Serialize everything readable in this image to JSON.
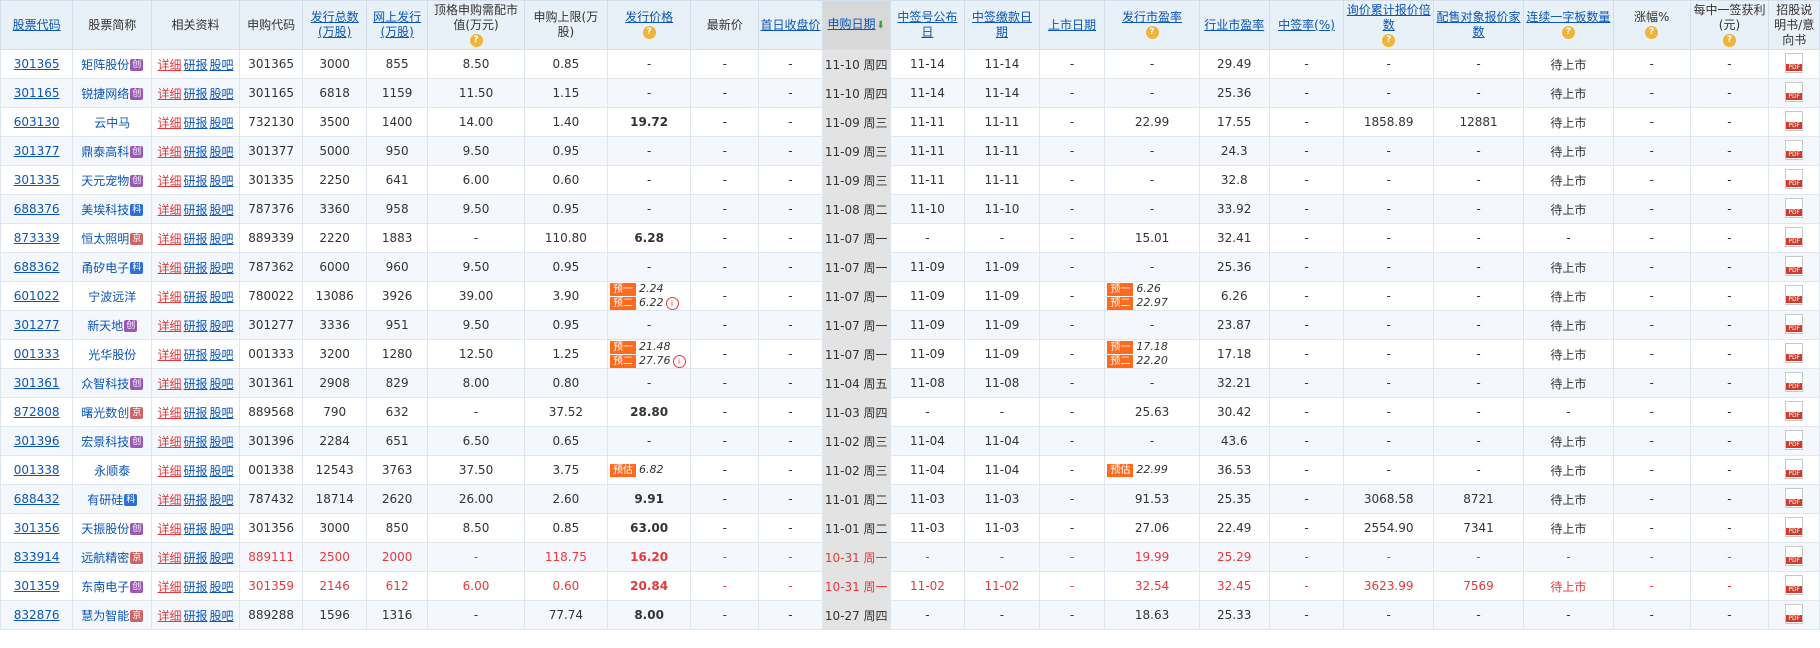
{
  "headers": [
    {
      "label": "股票代码",
      "link": true
    },
    {
      "label": "股票简称"
    },
    {
      "label": "相关资料"
    },
    {
      "label": "申购代码"
    },
    {
      "label": "发行总数(万股)",
      "link": true
    },
    {
      "label": "网上发行(万股)",
      "link": true
    },
    {
      "label": "顶格申购需配市值(万元)",
      "q": true
    },
    {
      "label": "申购上限(万股)"
    },
    {
      "label": "发行价格",
      "link": true,
      "q": true
    },
    {
      "label": "最新价"
    },
    {
      "label": "首日收盘价",
      "link": true
    },
    {
      "label": "申购日期",
      "link": true,
      "arrow": true
    },
    {
      "label": "中签号公布日",
      "link": true
    },
    {
      "label": "中签缴款日期",
      "link": true
    },
    {
      "label": "上市日期",
      "link": true
    },
    {
      "label": "发行市盈率",
      "link": true,
      "q": true
    },
    {
      "label": "行业市盈率",
      "link": true
    },
    {
      "label": "中签率(%)",
      "link": true
    },
    {
      "label": "询价累计报价倍数",
      "link": true,
      "q": true
    },
    {
      "label": "配售对象报价家数",
      "link": true
    },
    {
      "label": "连续一字板数量",
      "link": true,
      "q": true
    },
    {
      "label": "涨幅%",
      "q": true
    },
    {
      "label": "每中一签获利(元)",
      "q": true
    },
    {
      "label": "招股说明书/意向书"
    }
  ],
  "links": {
    "detail": "详细",
    "report": "研报",
    "forum": "股吧"
  },
  "pred_tags": {
    "p1": "预一",
    "p2": "预二",
    "est": "预估"
  },
  "rows": [
    {
      "code": "301365",
      "name": "矩阵股份",
      "tag": "创",
      "tagc": "cy",
      "sub": "301365",
      "total": "3000",
      "online": "855",
      "mv": "8.50",
      "limit": "0.85",
      "price": "-",
      "latest": "-",
      "first": "-",
      "date": "11-10 周四",
      "pub": "11-14",
      "pay": "11-14",
      "list": "-",
      "pe": "-",
      "ind": "29.49",
      "rate": "-",
      "mult": "-",
      "cnt": "-",
      "board": "待上市",
      "chg": "-",
      "profit": "-"
    },
    {
      "code": "301165",
      "name": "锐捷网络",
      "tag": "创",
      "tagc": "cy",
      "sub": "301165",
      "total": "6818",
      "online": "1159",
      "mv": "11.50",
      "limit": "1.15",
      "price": "-",
      "latest": "-",
      "first": "-",
      "date": "11-10 周四",
      "pub": "11-14",
      "pay": "11-14",
      "list": "-",
      "pe": "-",
      "ind": "25.36",
      "rate": "-",
      "mult": "-",
      "cnt": "-",
      "board": "待上市",
      "chg": "-",
      "profit": "-"
    },
    {
      "code": "603130",
      "name": "云中马",
      "tag": "",
      "tagc": "",
      "sub": "732130",
      "total": "3500",
      "online": "1400",
      "mv": "14.00",
      "limit": "1.40",
      "price": "19.72",
      "bold": true,
      "latest": "-",
      "first": "-",
      "date": "11-09 周三",
      "pub": "11-11",
      "pay": "11-11",
      "list": "-",
      "pe": "22.99",
      "ind": "17.55",
      "rate": "-",
      "mult": "1858.89",
      "cnt": "12881",
      "board": "待上市",
      "chg": "-",
      "profit": "-"
    },
    {
      "code": "301377",
      "name": "鼎泰高科",
      "tag": "创",
      "tagc": "cy",
      "sub": "301377",
      "total": "5000",
      "online": "950",
      "mv": "9.50",
      "limit": "0.95",
      "price": "-",
      "latest": "-",
      "first": "-",
      "date": "11-09 周三",
      "pub": "11-11",
      "pay": "11-11",
      "list": "-",
      "pe": "-",
      "ind": "24.3",
      "rate": "-",
      "mult": "-",
      "cnt": "-",
      "board": "待上市",
      "chg": "-",
      "profit": "-"
    },
    {
      "code": "301335",
      "name": "天元宠物",
      "tag": "创",
      "tagc": "cy",
      "sub": "301335",
      "total": "2250",
      "online": "641",
      "mv": "6.00",
      "limit": "0.60",
      "price": "-",
      "latest": "-",
      "first": "-",
      "date": "11-09 周三",
      "pub": "11-11",
      "pay": "11-11",
      "list": "-",
      "pe": "-",
      "ind": "32.8",
      "rate": "-",
      "mult": "-",
      "cnt": "-",
      "board": "待上市",
      "chg": "-",
      "profit": "-"
    },
    {
      "code": "688376",
      "name": "美埃科技",
      "tag": "科",
      "tagc": "kc",
      "sub": "787376",
      "total": "3360",
      "online": "958",
      "mv": "9.50",
      "limit": "0.95",
      "price": "-",
      "latest": "-",
      "first": "-",
      "date": "11-08 周二",
      "pub": "11-10",
      "pay": "11-10",
      "list": "-",
      "pe": "-",
      "ind": "33.92",
      "rate": "-",
      "mult": "-",
      "cnt": "-",
      "board": "待上市",
      "chg": "-",
      "profit": "-"
    },
    {
      "code": "873339",
      "name": "恒太照明",
      "tag": "京",
      "tagc": "bj",
      "sub": "889339",
      "total": "2220",
      "online": "1883",
      "mv": "-",
      "limit": "110.80",
      "price": "6.28",
      "bold": true,
      "latest": "-",
      "first": "-",
      "date": "11-07 周一",
      "pub": "-",
      "pay": "-",
      "list": "-",
      "pe": "15.01",
      "ind": "32.41",
      "rate": "-",
      "mult": "-",
      "cnt": "-",
      "board": "-",
      "chg": "-",
      "profit": "-"
    },
    {
      "code": "688362",
      "name": "甬矽电子",
      "tag": "科",
      "tagc": "kc",
      "sub": "787362",
      "total": "6000",
      "online": "960",
      "mv": "9.50",
      "limit": "0.95",
      "price": "-",
      "latest": "-",
      "first": "-",
      "date": "11-07 周一",
      "pub": "11-09",
      "pay": "11-09",
      "list": "-",
      "pe": "-",
      "ind": "25.36",
      "rate": "-",
      "mult": "-",
      "cnt": "-",
      "board": "待上市",
      "chg": "-",
      "profit": "-"
    },
    {
      "code": "601022",
      "name": "宁波远洋",
      "tag": "",
      "tagc": "",
      "sub": "780022",
      "total": "13086",
      "online": "3926",
      "mv": "39.00",
      "limit": "3.90",
      "price": "",
      "pred": [
        "2.24",
        "6.22"
      ],
      "info": true,
      "latest": "-",
      "first": "-",
      "date": "11-07 周一",
      "pub": "11-09",
      "pay": "11-09",
      "list": "-",
      "pe": "",
      "pepred": [
        "6.26",
        "22.97"
      ],
      "ind": "6.26",
      "rate": "-",
      "mult": "-",
      "cnt": "-",
      "board": "待上市",
      "chg": "-",
      "profit": "-"
    },
    {
      "code": "301277",
      "name": "新天地",
      "tag": "创",
      "tagc": "cy",
      "sub": "301277",
      "total": "3336",
      "online": "951",
      "mv": "9.50",
      "limit": "0.95",
      "price": "-",
      "latest": "-",
      "first": "-",
      "date": "11-07 周一",
      "pub": "11-09",
      "pay": "11-09",
      "list": "-",
      "pe": "-",
      "ind": "23.87",
      "rate": "-",
      "mult": "-",
      "cnt": "-",
      "board": "待上市",
      "chg": "-",
      "profit": "-"
    },
    {
      "code": "001333",
      "name": "光华股份",
      "tag": "",
      "tagc": "",
      "sub": "001333",
      "total": "3200",
      "online": "1280",
      "mv": "12.50",
      "limit": "1.25",
      "price": "",
      "pred": [
        "21.48",
        "27.76"
      ],
      "info": true,
      "latest": "-",
      "first": "-",
      "date": "11-07 周一",
      "pub": "11-09",
      "pay": "11-09",
      "list": "-",
      "pe": "",
      "pepred": [
        "17.18",
        "22.20"
      ],
      "ind": "17.18",
      "rate": "-",
      "mult": "-",
      "cnt": "-",
      "board": "待上市",
      "chg": "-",
      "profit": "-"
    },
    {
      "code": "301361",
      "name": "众智科技",
      "tag": "创",
      "tagc": "cy",
      "sub": "301361",
      "total": "2908",
      "online": "829",
      "mv": "8.00",
      "limit": "0.80",
      "price": "-",
      "latest": "-",
      "first": "-",
      "date": "11-04 周五",
      "pub": "11-08",
      "pay": "11-08",
      "list": "-",
      "pe": "-",
      "ind": "32.21",
      "rate": "-",
      "mult": "-",
      "cnt": "-",
      "board": "待上市",
      "chg": "-",
      "profit": "-"
    },
    {
      "code": "872808",
      "name": "曙光数创",
      "tag": "京",
      "tagc": "bj",
      "sub": "889568",
      "total": "790",
      "online": "632",
      "mv": "-",
      "limit": "37.52",
      "price": "28.80",
      "bold": true,
      "latest": "-",
      "first": "-",
      "date": "11-03 周四",
      "pub": "-",
      "pay": "-",
      "list": "-",
      "pe": "25.63",
      "ind": "30.42",
      "rate": "-",
      "mult": "-",
      "cnt": "-",
      "board": "-",
      "chg": "-",
      "profit": "-"
    },
    {
      "code": "301396",
      "name": "宏景科技",
      "tag": "创",
      "tagc": "cy",
      "sub": "301396",
      "total": "2284",
      "online": "651",
      "mv": "6.50",
      "limit": "0.65",
      "price": "-",
      "latest": "-",
      "first": "-",
      "date": "11-02 周三",
      "pub": "11-04",
      "pay": "11-04",
      "list": "-",
      "pe": "-",
      "ind": "43.6",
      "rate": "-",
      "mult": "-",
      "cnt": "-",
      "board": "待上市",
      "chg": "-",
      "profit": "-"
    },
    {
      "code": "001338",
      "name": "永顺泰",
      "tag": "",
      "tagc": "",
      "sub": "001338",
      "total": "12543",
      "online": "3763",
      "mv": "37.50",
      "limit": "3.75",
      "price": "",
      "est": "6.82",
      "latest": "-",
      "first": "-",
      "date": "11-02 周三",
      "pub": "11-04",
      "pay": "11-04",
      "list": "-",
      "pe": "",
      "peest": "22.99",
      "ind": "36.53",
      "rate": "-",
      "mult": "-",
      "cnt": "-",
      "board": "待上市",
      "chg": "-",
      "profit": "-"
    },
    {
      "code": "688432",
      "name": "有研硅",
      "tag": "科",
      "tagc": "kc",
      "sub": "787432",
      "total": "18714",
      "online": "2620",
      "mv": "26.00",
      "limit": "2.60",
      "price": "9.91",
      "bold": true,
      "latest": "-",
      "first": "-",
      "date": "11-01 周二",
      "pub": "11-03",
      "pay": "11-03",
      "list": "-",
      "pe": "91.53",
      "ind": "25.35",
      "rate": "-",
      "mult": "3068.58",
      "cnt": "8721",
      "board": "待上市",
      "chg": "-",
      "profit": "-"
    },
    {
      "code": "301356",
      "name": "天振股份",
      "tag": "创",
      "tagc": "cy",
      "sub": "301356",
      "total": "3000",
      "online": "850",
      "mv": "8.50",
      "limit": "0.85",
      "price": "63.00",
      "bold": true,
      "latest": "-",
      "first": "-",
      "date": "11-01 周二",
      "pub": "11-03",
      "pay": "11-03",
      "list": "-",
      "pe": "27.06",
      "ind": "22.49",
      "rate": "-",
      "mult": "2554.90",
      "cnt": "7341",
      "board": "待上市",
      "chg": "-",
      "profit": "-"
    },
    {
      "code": "833914",
      "name": "远航精密",
      "tag": "京",
      "tagc": "bj",
      "sub": "889111",
      "total": "2500",
      "online": "2000",
      "mv": "-",
      "limit": "118.75",
      "price": "16.20",
      "bold": true,
      "red": true,
      "latest": "-",
      "first": "-",
      "date": "10-31 周一",
      "pub": "-",
      "pay": "-",
      "list": "-",
      "pe": "19.99",
      "ind": "25.29",
      "rate": "-",
      "mult": "-",
      "cnt": "-",
      "board": "-",
      "chg": "-",
      "profit": "-"
    },
    {
      "code": "301359",
      "name": "东南电子",
      "tag": "创",
      "tagc": "cy",
      "sub": "301359",
      "total": "2146",
      "online": "612",
      "mv": "6.00",
      "limit": "0.60",
      "price": "20.84",
      "bold": true,
      "red": true,
      "latest": "-",
      "first": "-",
      "date": "10-31 周一",
      "pub": "11-02",
      "pay": "11-02",
      "list": "-",
      "pe": "32.54",
      "ind": "32.45",
      "rate": "-",
      "mult": "3623.99",
      "cnt": "7569",
      "board": "待上市",
      "chg": "-",
      "profit": "-"
    },
    {
      "code": "832876",
      "name": "慧为智能",
      "tag": "京",
      "tagc": "bj",
      "sub": "889288",
      "total": "1596",
      "online": "1316",
      "mv": "-",
      "limit": "77.74",
      "price": "8.00",
      "bold": true,
      "latest": "-",
      "first": "-",
      "date": "10-27 周四",
      "pub": "-",
      "pay": "-",
      "list": "-",
      "pe": "18.63",
      "ind": "25.33",
      "rate": "-",
      "mult": "-",
      "cnt": "-",
      "board": "-",
      "chg": "-",
      "profit": "-"
    }
  ]
}
